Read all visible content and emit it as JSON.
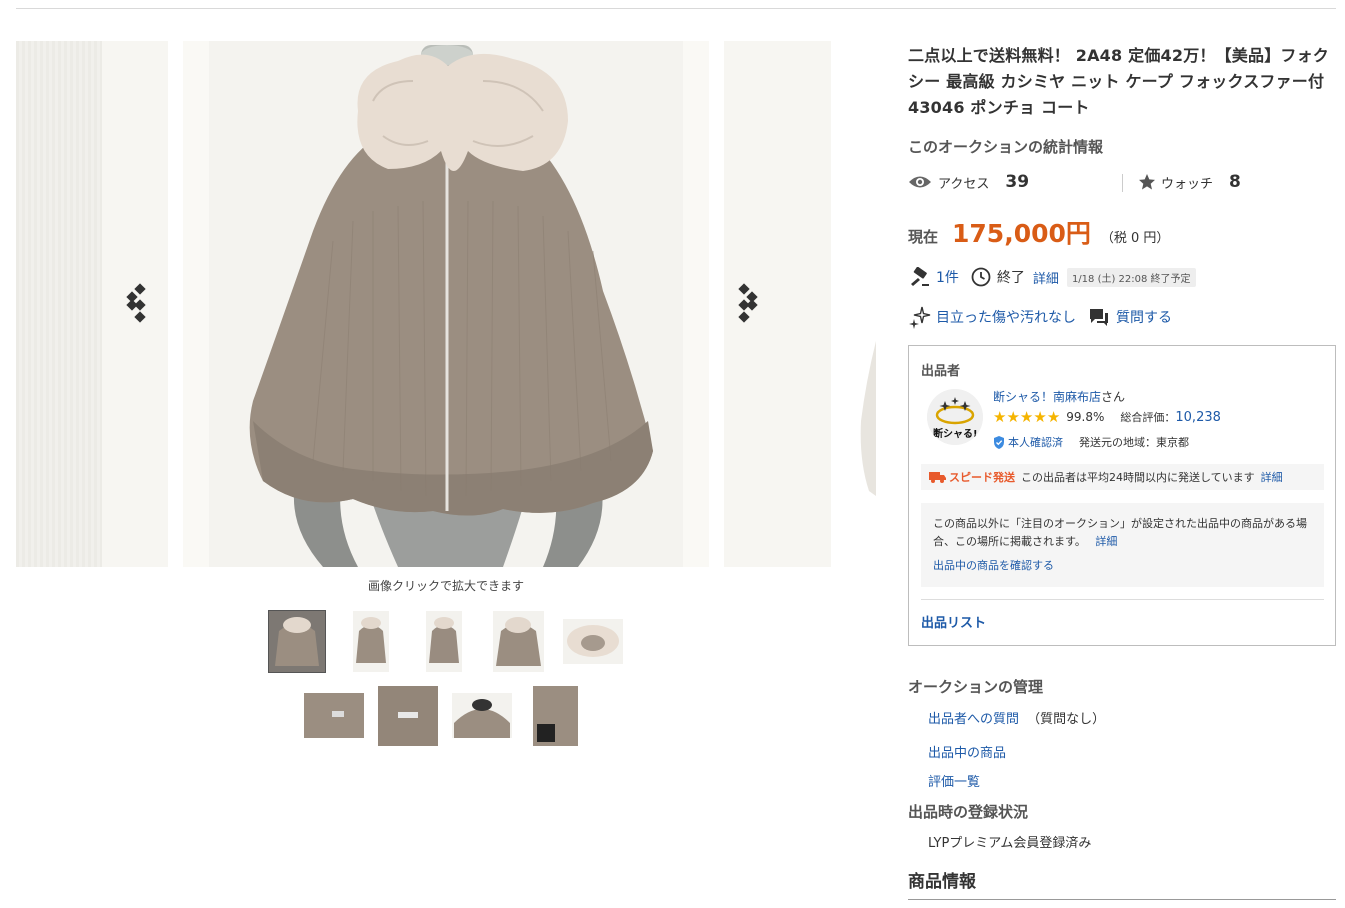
{
  "title": "二点以上で送料無料！ 2A48 定価42万！【美品】フォクシー 最高級 カシミヤ ニット ケープ フォックスファー付 43046 ポンチョ コート",
  "gallery": {
    "caption": "画像クリックで拡大できます",
    "thumbnail_count": 9,
    "selected_thumbnail": 1
  },
  "stats": {
    "heading": "このオークションの統計情報",
    "access_label": "アクセス",
    "access_count": "39",
    "watch_label": "ウォッチ",
    "watch_count": "8"
  },
  "price": {
    "label": "現在",
    "value": "175,000円",
    "tax": "（税 0 円）"
  },
  "bids": {
    "count": "1件",
    "end_label": "終了",
    "detail_link": "詳細",
    "end_time": "1/18 (土) 22:08 終了予定"
  },
  "condition": {
    "label": "目立った傷や汚れなし",
    "question_label": "質問する"
  },
  "seller": {
    "heading": "出品者",
    "avatar_text": "断シャる!",
    "name": "断シャる！南麻布店",
    "suffix": "さん",
    "rating_percent": "99.8%",
    "total_label": "総合評価：",
    "total_value": "10,238",
    "stars": 5,
    "verified_label": "本人確認済",
    "region": "発送元の地域：東京都",
    "speed_label": "スピード発送",
    "speed_text": "この出品者は平均24時間以内に発送しています",
    "speed_detail": "詳細",
    "notice_text": "この商品以外に「注目のオークション」が設定された出品中の商品がある場合、この場所に掲載されます。",
    "notice_detail": "詳細",
    "notice_link": "出品中の商品を確認する",
    "list_label": "出品リスト"
  },
  "management": {
    "heading": "オークションの管理",
    "question_link": "出品者への質問",
    "question_status": "（質問なし）",
    "items_link": "出品中の商品",
    "ratings_link": "評価一覧"
  },
  "registration": {
    "heading": "出品時の登録状況",
    "value": "LYPプレミアム会員登録済み"
  },
  "info_heading": "商品情報",
  "colors": {
    "price": "#d95c16",
    "link": "#1e5aa8",
    "star": "#f5b400",
    "speed": "#e85a2c"
  }
}
